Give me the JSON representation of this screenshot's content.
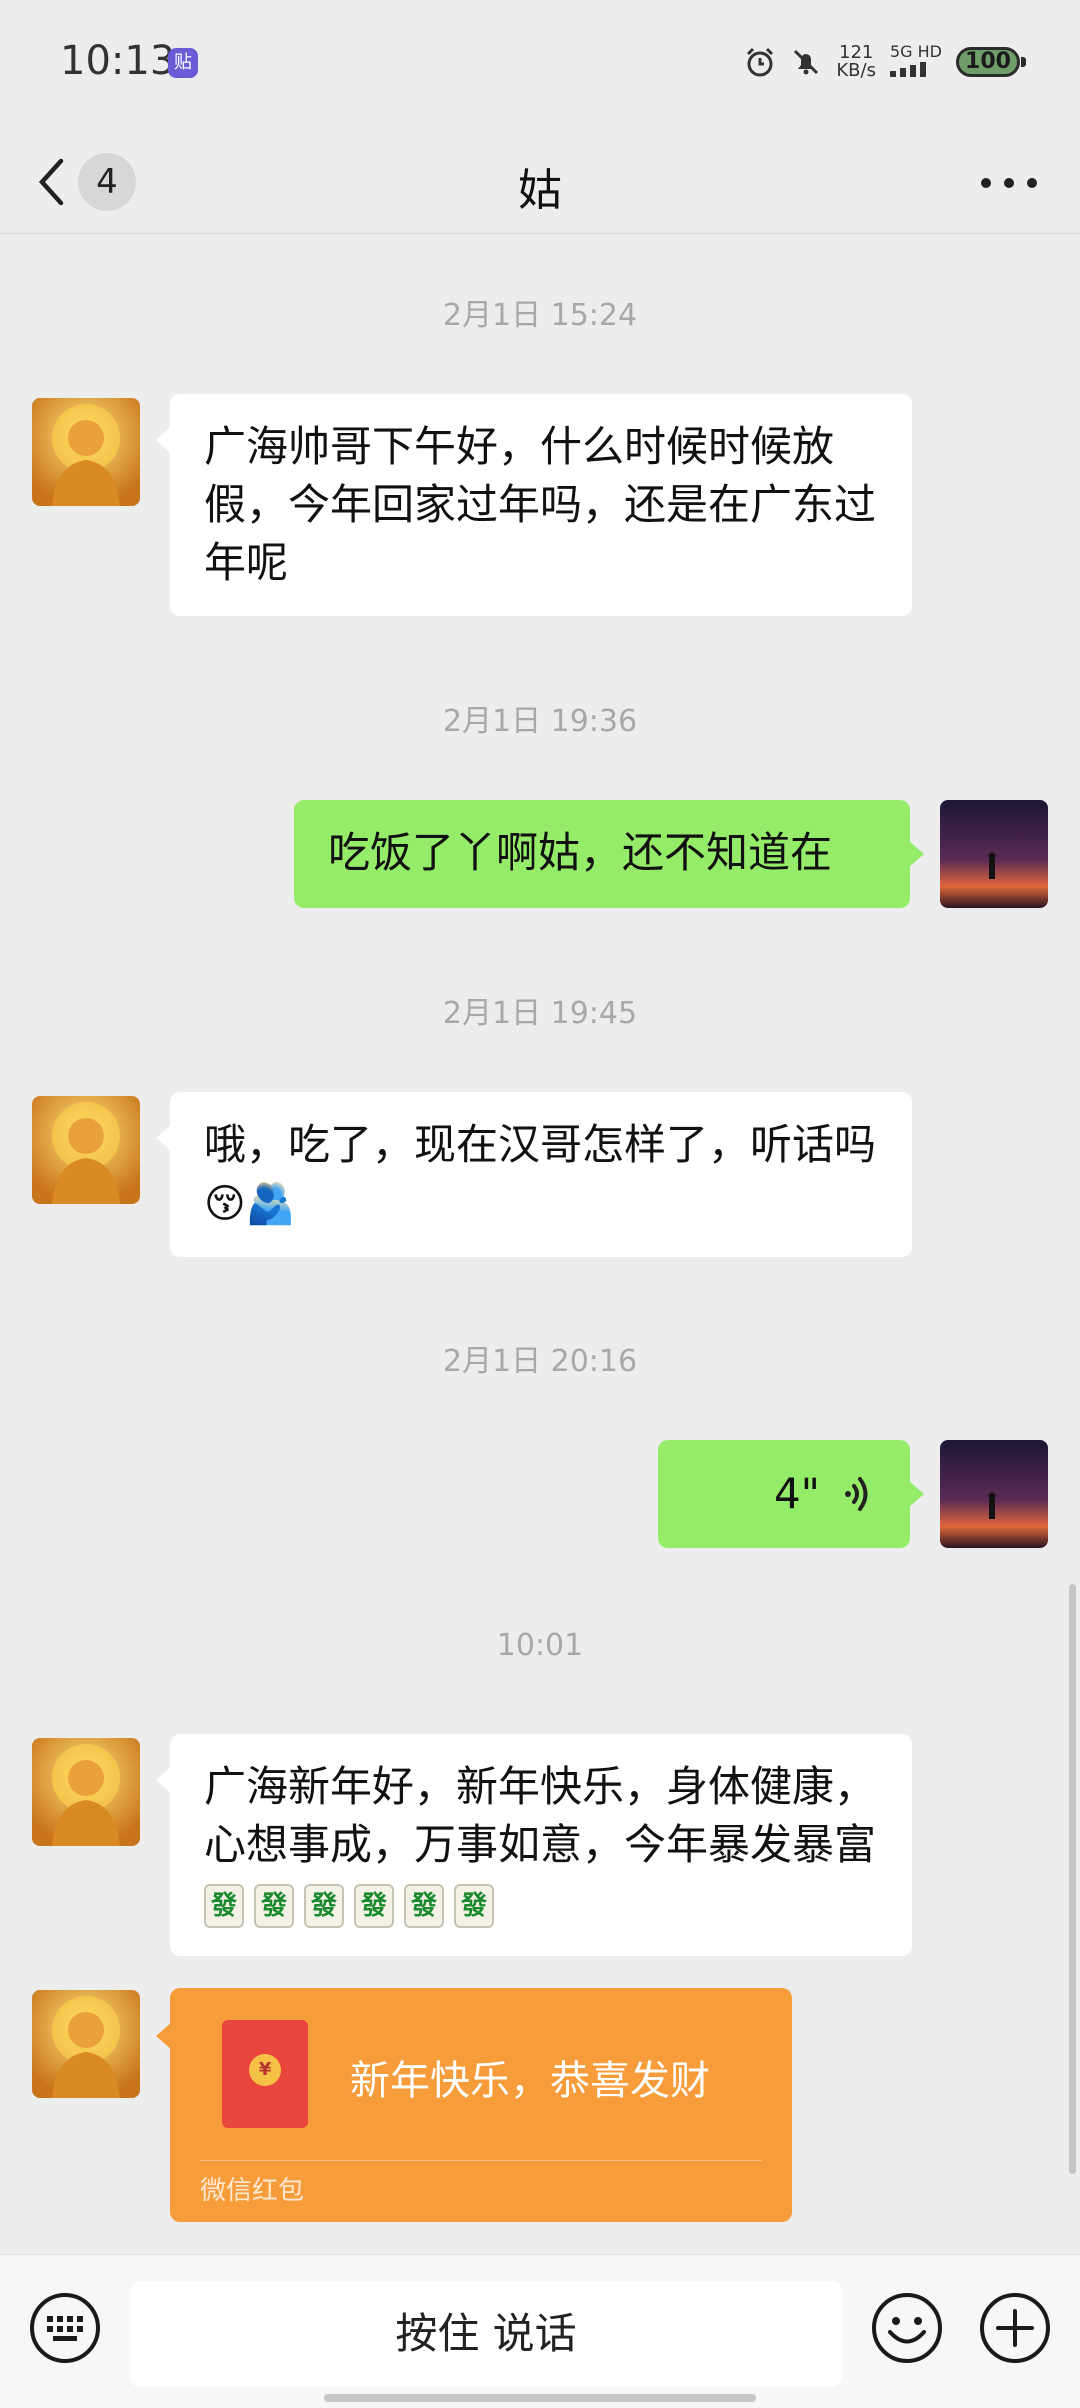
{
  "status_bar": {
    "time": "10:13",
    "app_badge": "贴",
    "net_speed_value": "121",
    "net_speed_unit": "KB/s",
    "signal_label": "5G HD",
    "battery": "100"
  },
  "nav": {
    "back_count": "4",
    "title": "姑"
  },
  "messages": {
    "ts1": "2月1日 15:24",
    "msg1": "广海帅哥下午好，什么时候时候放假，今年回家过年吗，还是在广东过年呢",
    "ts2": "2月1日 19:36",
    "msg2": "吃饭了丫啊姑，还不知道在",
    "ts3": "2月1日 19:45",
    "msg3_text": "哦，吃了，现在汉哥怎样了，听话吗",
    "msg3_emoji1": "😚",
    "msg3_emoji2": "🫂",
    "ts4": "2月1日 20:16",
    "voice_duration": "4\"",
    "ts5": "10:01",
    "msg5_text": "广海新年好，新年快乐，身体健康，心想事成，万事如意，今年暴发暴富",
    "mahjong_tile": "發",
    "redpacket_title": "新年快乐，恭喜发财",
    "redpacket_footer": "微信红包",
    "redpacket_coin": "¥"
  },
  "input_bar": {
    "hold_to_talk": "按住 说话"
  }
}
